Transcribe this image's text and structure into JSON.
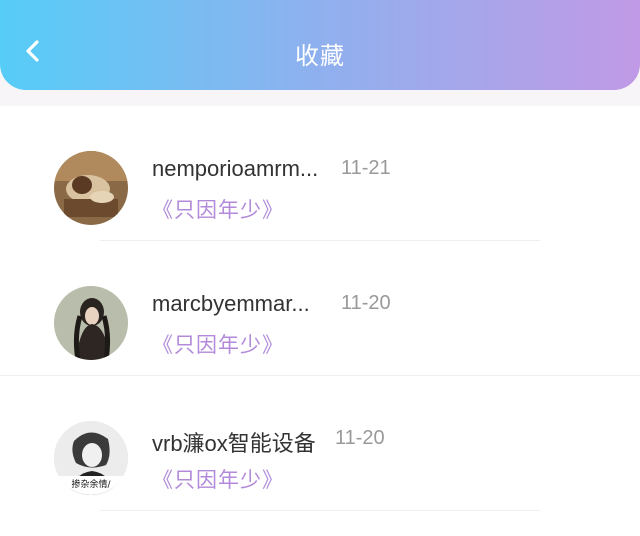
{
  "header": {
    "title": "收藏",
    "back_icon": "chevron-left-icon",
    "gradient": [
      "#56cdf7",
      "#c19ae6"
    ]
  },
  "items": [
    {
      "name": "nemporioamrm...",
      "date": "11-21",
      "work": "《只因年少》"
    },
    {
      "name": "marcbyemmar...",
      "date": "11-20",
      "work": "《只因年少》"
    },
    {
      "name": "vrb濂ox智能设备",
      "date": "11-20",
      "work": "《只因年少》",
      "avatar_caption": "掺杂余情/"
    }
  ],
  "colors": {
    "accent": "#b28ad9",
    "name_text": "#333333",
    "date_text": "#999999"
  }
}
